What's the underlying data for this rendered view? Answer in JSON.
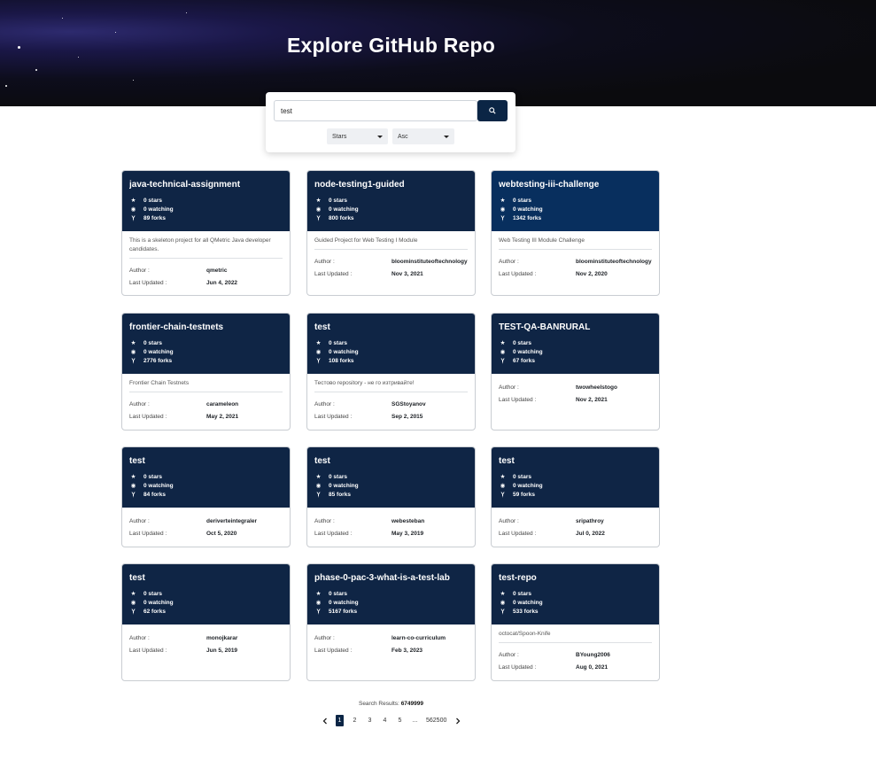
{
  "header": {
    "title": "Explore GitHub Repo"
  },
  "search": {
    "value": "test"
  },
  "filters": {
    "sort_by": "Stars",
    "order": "Asc"
  },
  "labels": {
    "author": "Author :",
    "updated": "Last Updated :"
  },
  "colors": {
    "card_header": "#0f2545",
    "card_header_alt": "#082f5e",
    "accent": "#0b2545"
  },
  "repos": [
    {
      "name": "java-technical-assignment",
      "stars": "0 stars",
      "watching": "0 watching",
      "forks": "89 forks",
      "description": "This is a skeleton project for all QMetric Java developer candidates.",
      "author": "qmetric",
      "updated": "Jun 4, 2022"
    },
    {
      "name": "node-testing1-guided",
      "stars": "0 stars",
      "watching": "0 watching",
      "forks": "800 forks",
      "description": "Guided Project for Web Testing I Module",
      "author": "bloominstituteoftechnology",
      "updated": "Nov 3, 2021"
    },
    {
      "name": "webtesting-iii-challenge",
      "stars": "0 stars",
      "watching": "0 watching",
      "forks": "1342 forks",
      "description": "Web Testing III Module Challenge",
      "author": "bloominstituteoftechnology",
      "updated": "Nov 2, 2020"
    },
    {
      "name": "frontier-chain-testnets",
      "stars": "0 stars",
      "watching": "0 watching",
      "forks": "2776 forks",
      "description": "Frontier Chain Testnets",
      "author": "carameleon",
      "updated": "May 2, 2021"
    },
    {
      "name": "test",
      "stars": "0 stars",
      "watching": "0 watching",
      "forks": "108 forks",
      "description": "Тестово repository - не го изтривайте!",
      "author": "SGStoyanov",
      "updated": "Sep 2, 2015"
    },
    {
      "name": "TEST-QA-BANRURAL",
      "stars": "0 stars",
      "watching": "0 watching",
      "forks": "67 forks",
      "description": "",
      "author": "twowheelstogo",
      "updated": "Nov 2, 2021"
    },
    {
      "name": "test",
      "stars": "0 stars",
      "watching": "0 watching",
      "forks": "84 forks",
      "description": "",
      "author": "deriverteintegraler",
      "updated": "Oct 5, 2020"
    },
    {
      "name": "test",
      "stars": "0 stars",
      "watching": "0 watching",
      "forks": "85 forks",
      "description": "",
      "author": "webesteban",
      "updated": "May 3, 2019"
    },
    {
      "name": "test",
      "stars": "0 stars",
      "watching": "0 watching",
      "forks": "59 forks",
      "description": "",
      "author": "sripathroy",
      "updated": "Jul 0, 2022"
    },
    {
      "name": "test",
      "stars": "0 stars",
      "watching": "0 watching",
      "forks": "62 forks",
      "description": "",
      "author": "monojkarar",
      "updated": "Jun 5, 2019"
    },
    {
      "name": "phase-0-pac-3-what-is-a-test-lab",
      "stars": "0 stars",
      "watching": "0 watching",
      "forks": "5167 forks",
      "description": "",
      "author": "learn-co-curriculum",
      "updated": "Feb 3, 2023"
    },
    {
      "name": "test-repo",
      "stars": "0 stars",
      "watching": "0 watching",
      "forks": "533 forks",
      "description": "octocat/Spoon-Knife",
      "author": "BYoung2006",
      "updated": "Aug 0, 2021"
    }
  ],
  "results": {
    "label": "Search Results:",
    "count": "6749999"
  },
  "pagination": {
    "pages": [
      "1",
      "2",
      "3",
      "4",
      "5",
      "...",
      "562500"
    ],
    "current": "1"
  }
}
